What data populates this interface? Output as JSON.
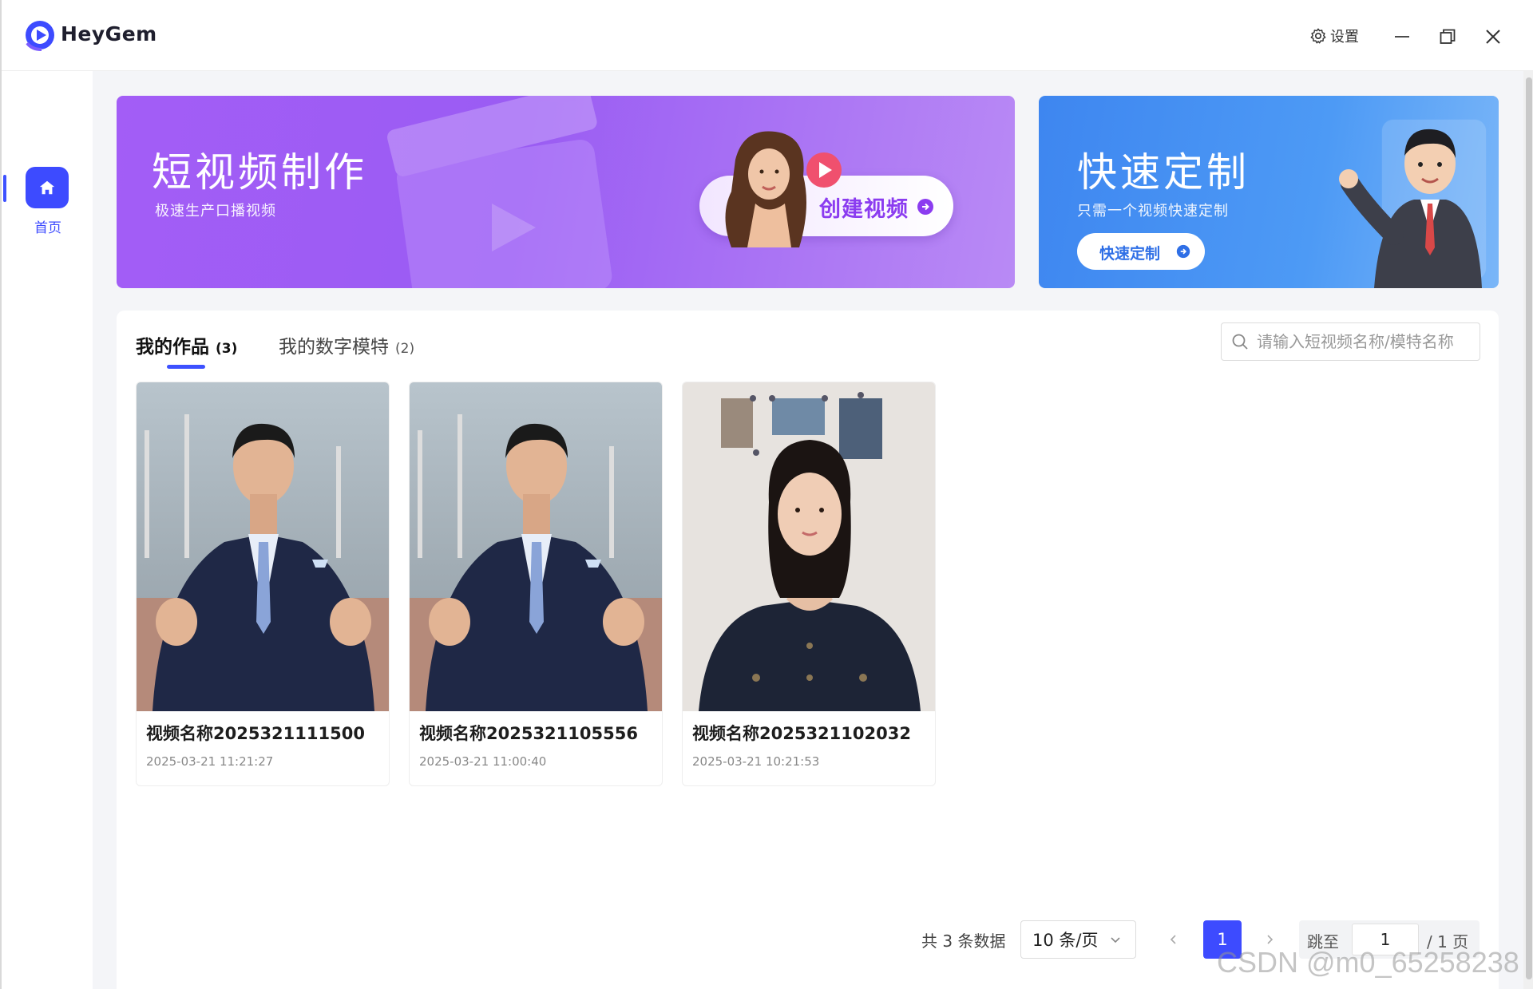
{
  "app": {
    "name": "HeyGem"
  },
  "titlebar": {
    "settings_label": "设置"
  },
  "sidebar": {
    "items": [
      {
        "label": "首页",
        "icon": "home-icon",
        "active": true
      }
    ]
  },
  "banners": {
    "short_video": {
      "title": "短视频制作",
      "subtitle": "极速生产口播视频",
      "button_label": "创建视频"
    },
    "quick_custom": {
      "title": "快速定制",
      "subtitle": "只需一个视频快速定制",
      "button_label": "快速定制"
    }
  },
  "tabs": [
    {
      "label": "我的作品",
      "count": "(3)",
      "active": true
    },
    {
      "label": "我的数字模特",
      "count": "(2)",
      "active": false
    }
  ],
  "search": {
    "placeholder": "请输入短视频名称/模特名称",
    "value": ""
  },
  "works": [
    {
      "title": "视频名称2025321111500",
      "date": "2025-03-21 11:21:27",
      "thumb": "man"
    },
    {
      "title": "视频名称2025321105556",
      "date": "2025-03-21 11:00:40",
      "thumb": "man"
    },
    {
      "title": "视频名称2025321102032",
      "date": "2025-03-21 10:21:53",
      "thumb": "woman"
    }
  ],
  "pagination": {
    "total_text": "共 3 条数据",
    "page_size": "10 条/页",
    "current_page": "1",
    "jump_label": "跳至",
    "jump_value": "1",
    "total_pages_text": "/ 1 页"
  },
  "watermark": "CSDN @m0_65258238",
  "colors": {
    "accent": "#3d4bff",
    "purple_banner": "#a35df6",
    "blue_banner": "#3e86f0"
  }
}
